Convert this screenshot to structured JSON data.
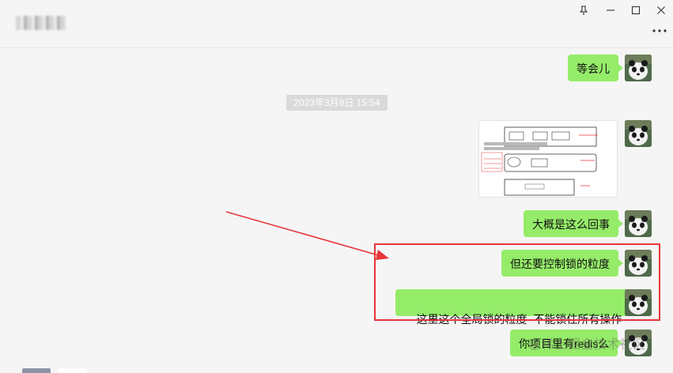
{
  "window": {
    "pin_icon": "pin-icon",
    "minimize_icon": "minimize-icon",
    "maximize_icon": "maximize-icon",
    "close_icon": "close-icon",
    "more_icon": "more-icon"
  },
  "messages": [
    {
      "type": "text",
      "text": "等会儿"
    },
    {
      "type": "timestamp",
      "text": "2023年3月8日 15:54"
    },
    {
      "type": "image"
    },
    {
      "type": "text",
      "text": "大概是这么回事"
    },
    {
      "type": "text",
      "text": "但还要控制锁的粒度"
    },
    {
      "type": "text",
      "text": "这里这个全局锁的粒度  不能锁住所有操作"
    },
    {
      "type": "text",
      "text": "你项目里有redis么"
    }
  ],
  "watermark": "@稀土掘金技术社区",
  "colors": {
    "bubble": "#95ec69",
    "highlight": "#e8363a",
    "background": "#f5f5f5"
  }
}
